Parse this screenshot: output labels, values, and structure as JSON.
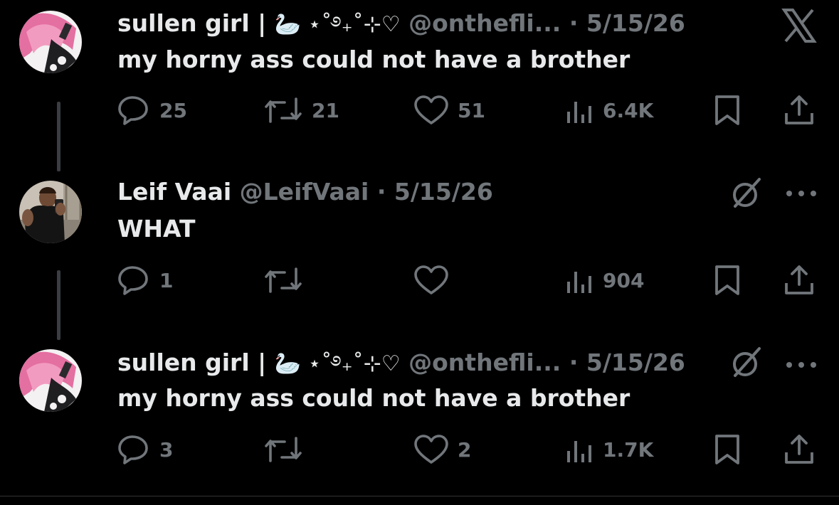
{
  "theme": {
    "background": "#000000",
    "text": "#e7e9ea",
    "muted": "#71767b",
    "thread_line": "#3a3d41"
  },
  "app": {
    "logo_icon": "x-logo-icon"
  },
  "tweets": [
    {
      "name": "sullen girl |",
      "decor": "🦢 ⋆˚࿔₊˚⊹♡",
      "handle": "@onthefli...",
      "separator": "·",
      "date": "5/15/26",
      "text": "my horny ass could not have a brother",
      "avatar_icon": "pink-hair-anime-avatar",
      "replies": "25",
      "reposts": "21",
      "likes": "51",
      "views": "6.4K"
    },
    {
      "name": "Leif Vaai",
      "handle": "@LeifVaai",
      "separator": "·",
      "date": "5/15/26",
      "text": "WHAT",
      "avatar_icon": "mirror-selfie-avatar",
      "replies": "1",
      "reposts": "",
      "likes": "",
      "views": "904"
    },
    {
      "name": "sullen girl |",
      "decor": "🦢 ⋆˚࿔₊˚⊹♡",
      "handle": "@onthefli...",
      "separator": "·",
      "date": "5/15/26",
      "text": "my horny ass could not have a brother",
      "avatar_icon": "pink-hair-anime-avatar",
      "replies": "3",
      "reposts": "",
      "likes": "2",
      "views": "1.7K"
    }
  ]
}
